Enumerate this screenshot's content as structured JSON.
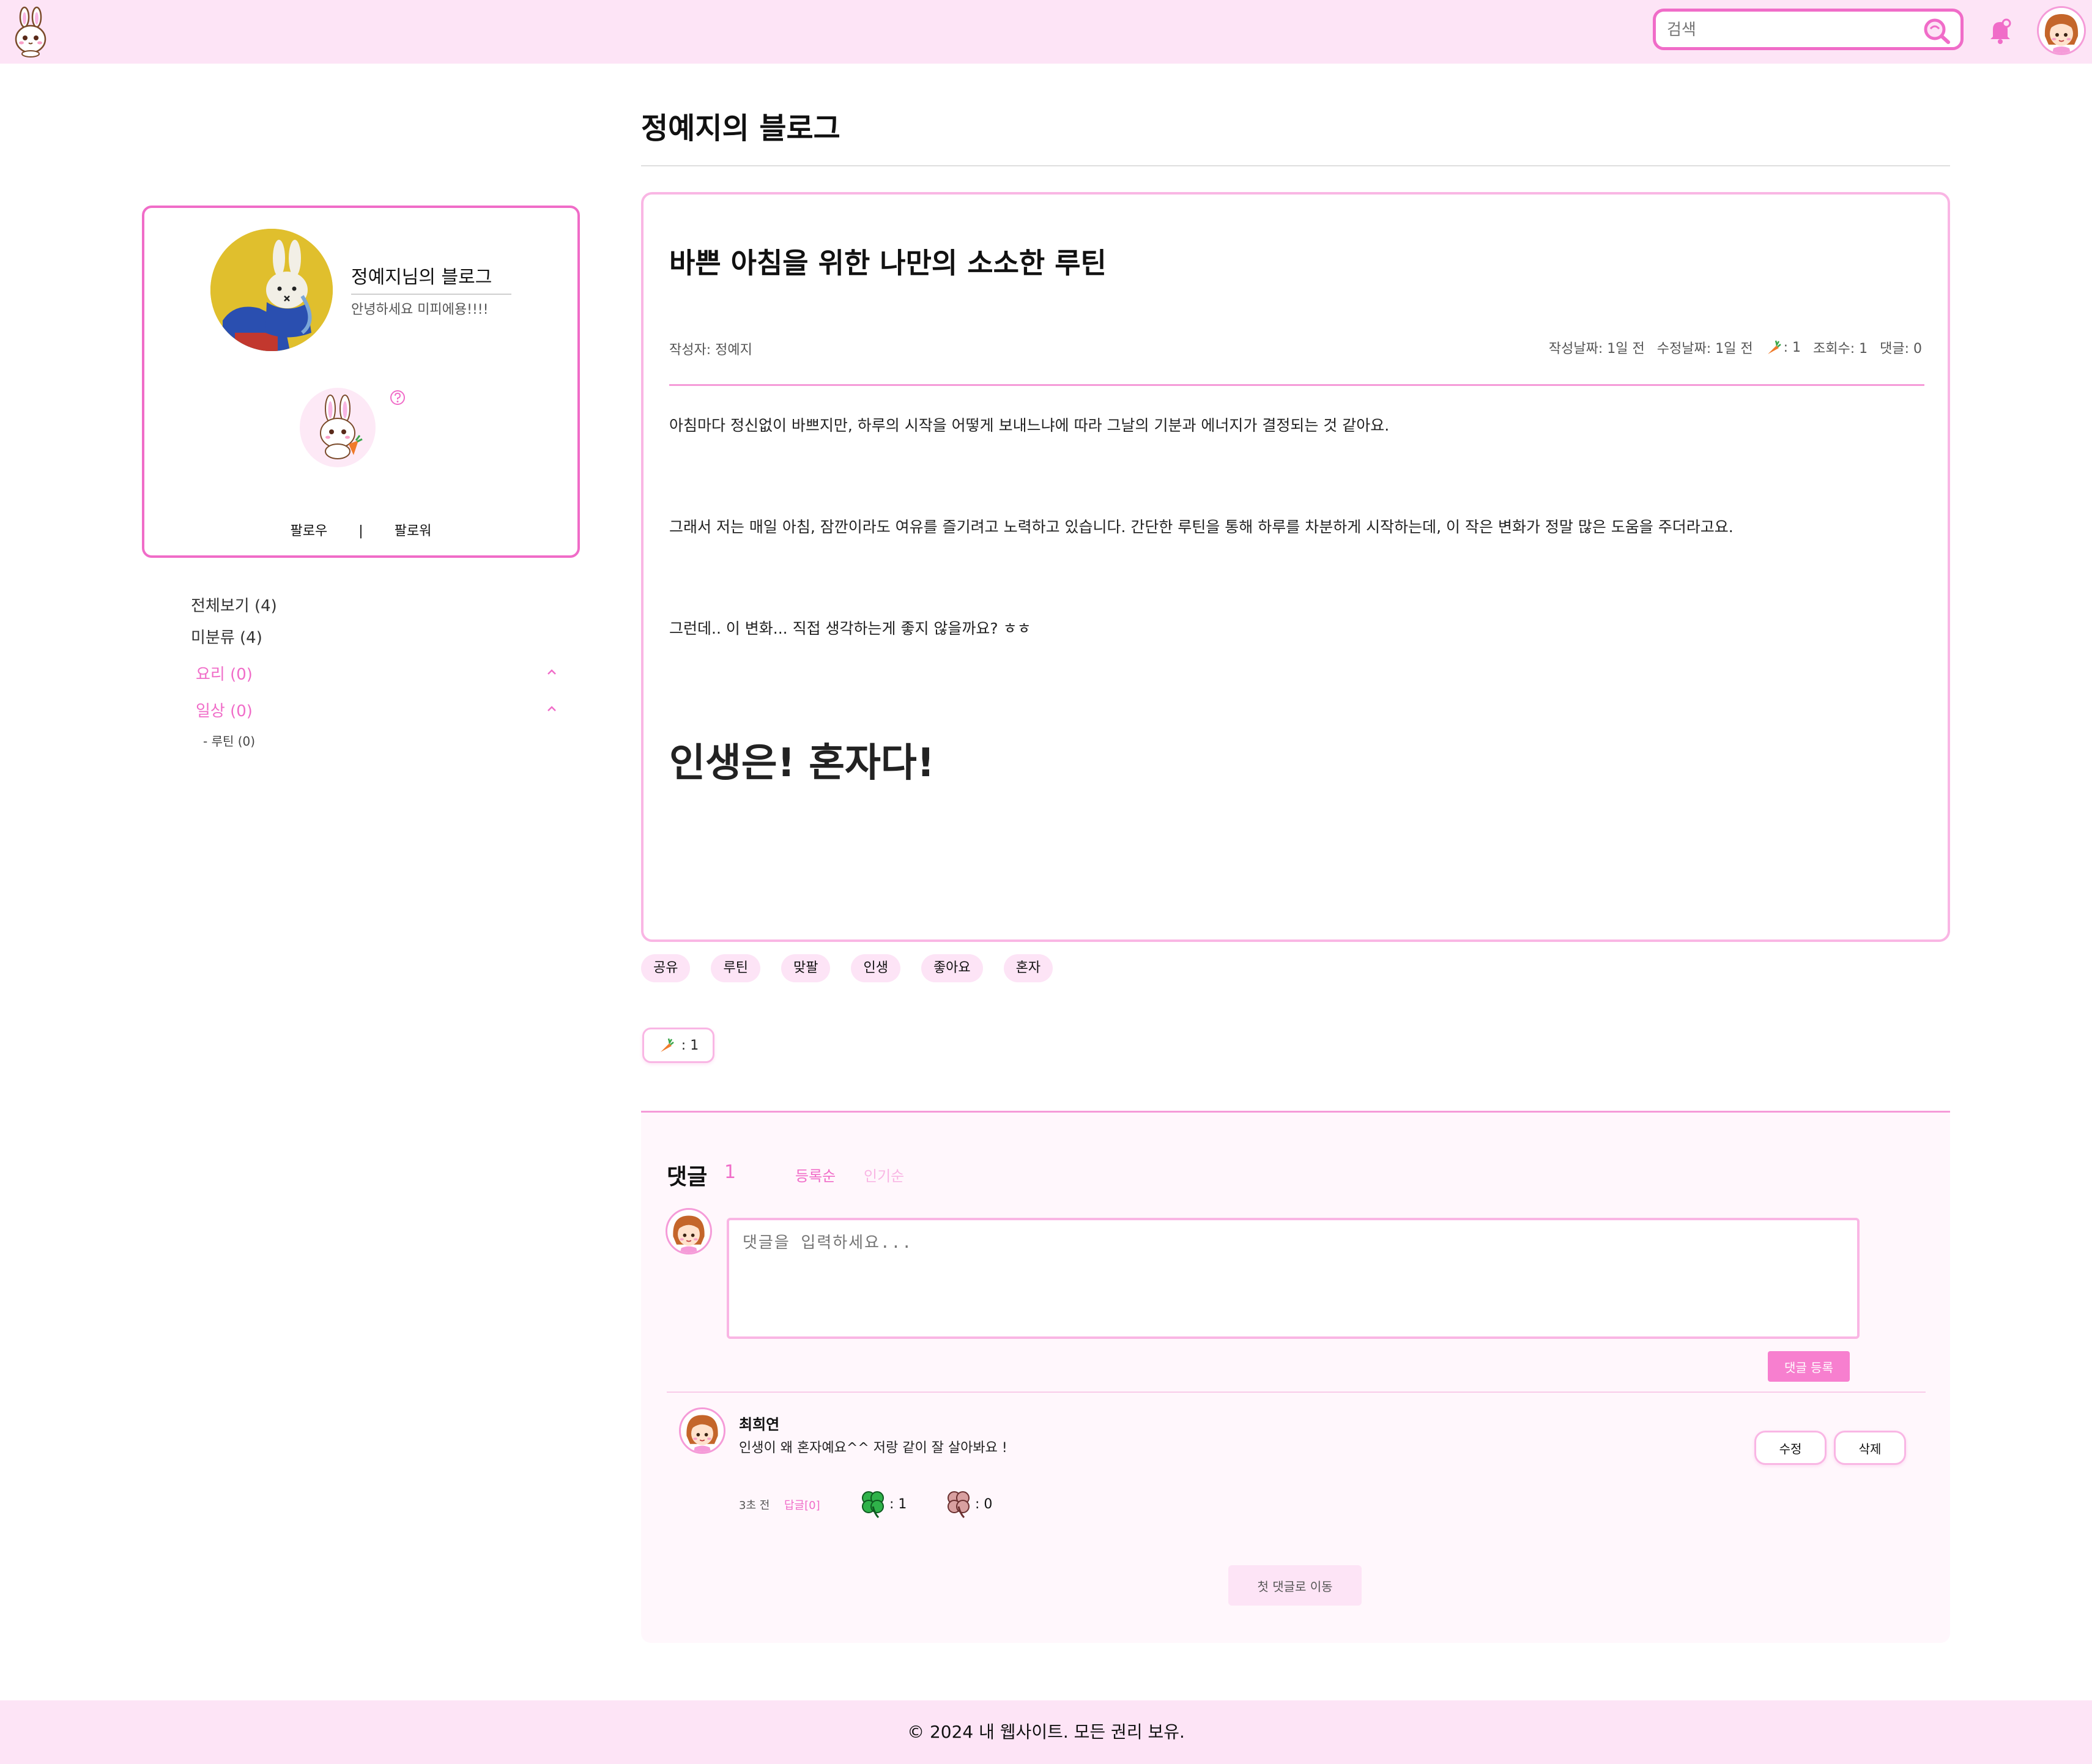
{
  "header": {
    "search_placeholder": "검색",
    "icons": [
      "bunny-logo-icon",
      "search-icon",
      "bell-icon",
      "avatar"
    ]
  },
  "page": {
    "title": "정예지의 블로그"
  },
  "profile": {
    "blog_name": "정예지님의 블로그",
    "intro": "안녕하세요 미피에용!!!!",
    "follow": "팔로우",
    "divider": "|",
    "follower": "팔로워"
  },
  "categories": {
    "all": "전체보기 (4)",
    "uncategorized": "미분류 (4)",
    "cooking": "요리 (0)",
    "daily": "일상 (0)",
    "routine": "- 루틴 (0)"
  },
  "post": {
    "title": "바쁜 아침을 위한 나만의 소소한 루틴",
    "author": "작성자: 정예지",
    "created": "작성날짜: 1일 전",
    "modified": "수정날짜: 1일 전",
    "carrots": ": 1",
    "views": "조회수: 1",
    "comments": "댓글: 0",
    "para1": "아침마다 정신없이 바쁘지만, 하루의 시작을 어떻게 보내느냐에 따라 그날의 기분과 에너지가 결정되는 것 같아요.",
    "para2": "그래서 저는 매일 아침, 잠깐이라도 여유를 즐기려고 노력하고 있습니다. 간단한 루틴을 통해 하루를 차분하게 시작하는데, 이 작은 변화가 정말 많은 도움을 주더라고요.",
    "para3": "그런데.. 이 변화... 직접 생각하는게 좋지 않을까요? ㅎㅎ",
    "big": "인생은! 혼자다!"
  },
  "tags": [
    "공유",
    "루틴",
    "맞팔",
    "인생",
    "좋아요",
    "혼자"
  ],
  "like": {
    "label": ":  1"
  },
  "comment_section": {
    "title": "댓글",
    "count": "1",
    "sort_recent": "등록순",
    "sort_popular": "인기순",
    "placeholder": "댓글을 입력하세요...",
    "submit": "댓글 등록",
    "first_button": "첫 댓글로 이동"
  },
  "comment": {
    "author": "최희연",
    "text": "인생이 왜 혼자예요^^ 저랑 같이 잘 살아봐요 !",
    "edit": "수정",
    "delete": "삭제",
    "time": "3초 전",
    "reply": "답글[0]",
    "like_count": ":  1",
    "dislike_count": ":  0"
  },
  "footer": {
    "text": "© 2024 내 웹사이트. 모든 권리 보유."
  },
  "colors": {
    "brand_pink": "#f06cc8",
    "light_pink": "#fde4f6",
    "border_pink": "#f9b6e4"
  }
}
